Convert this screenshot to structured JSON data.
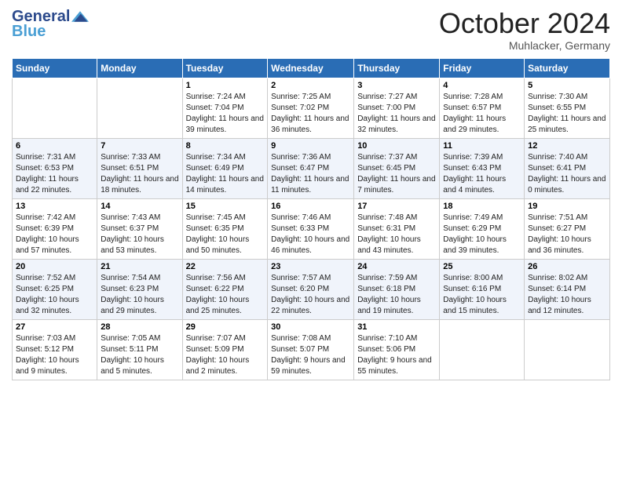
{
  "header": {
    "logo_text_general": "General",
    "logo_text_blue": "Blue",
    "month": "October 2024",
    "location": "Muhlacker, Germany"
  },
  "days_of_week": [
    "Sunday",
    "Monday",
    "Tuesday",
    "Wednesday",
    "Thursday",
    "Friday",
    "Saturday"
  ],
  "weeks": [
    [
      {
        "day": "",
        "sunrise": "",
        "sunset": "",
        "daylight": ""
      },
      {
        "day": "",
        "sunrise": "",
        "sunset": "",
        "daylight": ""
      },
      {
        "day": "1",
        "sunrise": "Sunrise: 7:24 AM",
        "sunset": "Sunset: 7:04 PM",
        "daylight": "Daylight: 11 hours and 39 minutes."
      },
      {
        "day": "2",
        "sunrise": "Sunrise: 7:25 AM",
        "sunset": "Sunset: 7:02 PM",
        "daylight": "Daylight: 11 hours and 36 minutes."
      },
      {
        "day": "3",
        "sunrise": "Sunrise: 7:27 AM",
        "sunset": "Sunset: 7:00 PM",
        "daylight": "Daylight: 11 hours and 32 minutes."
      },
      {
        "day": "4",
        "sunrise": "Sunrise: 7:28 AM",
        "sunset": "Sunset: 6:57 PM",
        "daylight": "Daylight: 11 hours and 29 minutes."
      },
      {
        "day": "5",
        "sunrise": "Sunrise: 7:30 AM",
        "sunset": "Sunset: 6:55 PM",
        "daylight": "Daylight: 11 hours and 25 minutes."
      }
    ],
    [
      {
        "day": "6",
        "sunrise": "Sunrise: 7:31 AM",
        "sunset": "Sunset: 6:53 PM",
        "daylight": "Daylight: 11 hours and 22 minutes."
      },
      {
        "day": "7",
        "sunrise": "Sunrise: 7:33 AM",
        "sunset": "Sunset: 6:51 PM",
        "daylight": "Daylight: 11 hours and 18 minutes."
      },
      {
        "day": "8",
        "sunrise": "Sunrise: 7:34 AM",
        "sunset": "Sunset: 6:49 PM",
        "daylight": "Daylight: 11 hours and 14 minutes."
      },
      {
        "day": "9",
        "sunrise": "Sunrise: 7:36 AM",
        "sunset": "Sunset: 6:47 PM",
        "daylight": "Daylight: 11 hours and 11 minutes."
      },
      {
        "day": "10",
        "sunrise": "Sunrise: 7:37 AM",
        "sunset": "Sunset: 6:45 PM",
        "daylight": "Daylight: 11 hours and 7 minutes."
      },
      {
        "day": "11",
        "sunrise": "Sunrise: 7:39 AM",
        "sunset": "Sunset: 6:43 PM",
        "daylight": "Daylight: 11 hours and 4 minutes."
      },
      {
        "day": "12",
        "sunrise": "Sunrise: 7:40 AM",
        "sunset": "Sunset: 6:41 PM",
        "daylight": "Daylight: 11 hours and 0 minutes."
      }
    ],
    [
      {
        "day": "13",
        "sunrise": "Sunrise: 7:42 AM",
        "sunset": "Sunset: 6:39 PM",
        "daylight": "Daylight: 10 hours and 57 minutes."
      },
      {
        "day": "14",
        "sunrise": "Sunrise: 7:43 AM",
        "sunset": "Sunset: 6:37 PM",
        "daylight": "Daylight: 10 hours and 53 minutes."
      },
      {
        "day": "15",
        "sunrise": "Sunrise: 7:45 AM",
        "sunset": "Sunset: 6:35 PM",
        "daylight": "Daylight: 10 hours and 50 minutes."
      },
      {
        "day": "16",
        "sunrise": "Sunrise: 7:46 AM",
        "sunset": "Sunset: 6:33 PM",
        "daylight": "Daylight: 10 hours and 46 minutes."
      },
      {
        "day": "17",
        "sunrise": "Sunrise: 7:48 AM",
        "sunset": "Sunset: 6:31 PM",
        "daylight": "Daylight: 10 hours and 43 minutes."
      },
      {
        "day": "18",
        "sunrise": "Sunrise: 7:49 AM",
        "sunset": "Sunset: 6:29 PM",
        "daylight": "Daylight: 10 hours and 39 minutes."
      },
      {
        "day": "19",
        "sunrise": "Sunrise: 7:51 AM",
        "sunset": "Sunset: 6:27 PM",
        "daylight": "Daylight: 10 hours and 36 minutes."
      }
    ],
    [
      {
        "day": "20",
        "sunrise": "Sunrise: 7:52 AM",
        "sunset": "Sunset: 6:25 PM",
        "daylight": "Daylight: 10 hours and 32 minutes."
      },
      {
        "day": "21",
        "sunrise": "Sunrise: 7:54 AM",
        "sunset": "Sunset: 6:23 PM",
        "daylight": "Daylight: 10 hours and 29 minutes."
      },
      {
        "day": "22",
        "sunrise": "Sunrise: 7:56 AM",
        "sunset": "Sunset: 6:22 PM",
        "daylight": "Daylight: 10 hours and 25 minutes."
      },
      {
        "day": "23",
        "sunrise": "Sunrise: 7:57 AM",
        "sunset": "Sunset: 6:20 PM",
        "daylight": "Daylight: 10 hours and 22 minutes."
      },
      {
        "day": "24",
        "sunrise": "Sunrise: 7:59 AM",
        "sunset": "Sunset: 6:18 PM",
        "daylight": "Daylight: 10 hours and 19 minutes."
      },
      {
        "day": "25",
        "sunrise": "Sunrise: 8:00 AM",
        "sunset": "Sunset: 6:16 PM",
        "daylight": "Daylight: 10 hours and 15 minutes."
      },
      {
        "day": "26",
        "sunrise": "Sunrise: 8:02 AM",
        "sunset": "Sunset: 6:14 PM",
        "daylight": "Daylight: 10 hours and 12 minutes."
      }
    ],
    [
      {
        "day": "27",
        "sunrise": "Sunrise: 7:03 AM",
        "sunset": "Sunset: 5:12 PM",
        "daylight": "Daylight: 10 hours and 9 minutes."
      },
      {
        "day": "28",
        "sunrise": "Sunrise: 7:05 AM",
        "sunset": "Sunset: 5:11 PM",
        "daylight": "Daylight: 10 hours and 5 minutes."
      },
      {
        "day": "29",
        "sunrise": "Sunrise: 7:07 AM",
        "sunset": "Sunset: 5:09 PM",
        "daylight": "Daylight: 10 hours and 2 minutes."
      },
      {
        "day": "30",
        "sunrise": "Sunrise: 7:08 AM",
        "sunset": "Sunset: 5:07 PM",
        "daylight": "Daylight: 9 hours and 59 minutes."
      },
      {
        "day": "31",
        "sunrise": "Sunrise: 7:10 AM",
        "sunset": "Sunset: 5:06 PM",
        "daylight": "Daylight: 9 hours and 55 minutes."
      },
      {
        "day": "",
        "sunrise": "",
        "sunset": "",
        "daylight": ""
      },
      {
        "day": "",
        "sunrise": "",
        "sunset": "",
        "daylight": ""
      }
    ]
  ]
}
